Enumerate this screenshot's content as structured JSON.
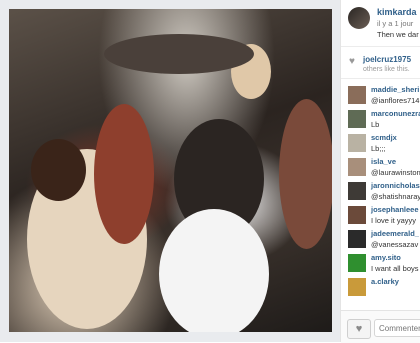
{
  "header": {
    "username": "kimkarda",
    "time": "il y a 1 jour",
    "caption": "Then we dar"
  },
  "likes": {
    "user": "joelcruz1975",
    "text": "others like this."
  },
  "comments": [
    {
      "user": "maddie_sheri",
      "text": "@ianflores714",
      "color": "#8a6d5a"
    },
    {
      "user": "marconunezra",
      "text": "Lb",
      "color": "#5f6b55"
    },
    {
      "user": "scmdjx",
      "text": "Lb;;;",
      "color": "#b9b2a3"
    },
    {
      "user": "isla_ve",
      "text": "@laurawinston",
      "color": "#a88f7b"
    },
    {
      "user": "jaronnicholas",
      "text": "@shatishnaray",
      "color": "#3e3a36"
    },
    {
      "user": "josephanleee",
      "text": "I love it yayyy",
      "color": "#6b4a3a"
    },
    {
      "user": "jadeemerald_",
      "text": "@vanessazav",
      "color": "#2a2a2a"
    },
    {
      "user": "amy.sito",
      "text": "I want all boys",
      "color": "#2f8f2f"
    },
    {
      "user": "a.clarky",
      "text": "",
      "color": "#c99a3a"
    }
  ],
  "footer": {
    "comment_placeholder": "Commenter"
  }
}
